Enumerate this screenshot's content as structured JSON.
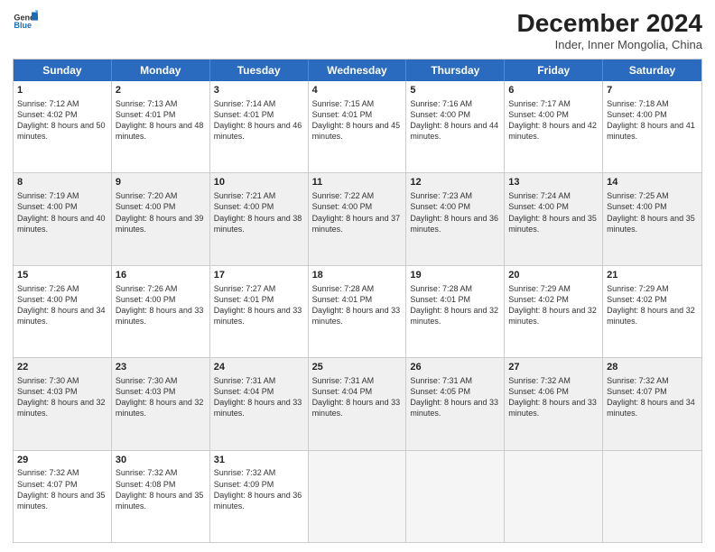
{
  "header": {
    "logo_line1": "General",
    "logo_line2": "Blue",
    "month_title": "December 2024",
    "subtitle": "Inder, Inner Mongolia, China"
  },
  "days_of_week": [
    "Sunday",
    "Monday",
    "Tuesday",
    "Wednesday",
    "Thursday",
    "Friday",
    "Saturday"
  ],
  "weeks": [
    [
      {
        "day": 1,
        "sunrise": "7:12 AM",
        "sunset": "4:02 PM",
        "daylight": "8 hours and 50 minutes."
      },
      {
        "day": 2,
        "sunrise": "7:13 AM",
        "sunset": "4:01 PM",
        "daylight": "8 hours and 48 minutes."
      },
      {
        "day": 3,
        "sunrise": "7:14 AM",
        "sunset": "4:01 PM",
        "daylight": "8 hours and 46 minutes."
      },
      {
        "day": 4,
        "sunrise": "7:15 AM",
        "sunset": "4:01 PM",
        "daylight": "8 hours and 45 minutes."
      },
      {
        "day": 5,
        "sunrise": "7:16 AM",
        "sunset": "4:00 PM",
        "daylight": "8 hours and 44 minutes."
      },
      {
        "day": 6,
        "sunrise": "7:17 AM",
        "sunset": "4:00 PM",
        "daylight": "8 hours and 42 minutes."
      },
      {
        "day": 7,
        "sunrise": "7:18 AM",
        "sunset": "4:00 PM",
        "daylight": "8 hours and 41 minutes."
      }
    ],
    [
      {
        "day": 8,
        "sunrise": "7:19 AM",
        "sunset": "4:00 PM",
        "daylight": "8 hours and 40 minutes."
      },
      {
        "day": 9,
        "sunrise": "7:20 AM",
        "sunset": "4:00 PM",
        "daylight": "8 hours and 39 minutes."
      },
      {
        "day": 10,
        "sunrise": "7:21 AM",
        "sunset": "4:00 PM",
        "daylight": "8 hours and 38 minutes."
      },
      {
        "day": 11,
        "sunrise": "7:22 AM",
        "sunset": "4:00 PM",
        "daylight": "8 hours and 37 minutes."
      },
      {
        "day": 12,
        "sunrise": "7:23 AM",
        "sunset": "4:00 PM",
        "daylight": "8 hours and 36 minutes."
      },
      {
        "day": 13,
        "sunrise": "7:24 AM",
        "sunset": "4:00 PM",
        "daylight": "8 hours and 35 minutes."
      },
      {
        "day": 14,
        "sunrise": "7:25 AM",
        "sunset": "4:00 PM",
        "daylight": "8 hours and 35 minutes."
      }
    ],
    [
      {
        "day": 15,
        "sunrise": "7:26 AM",
        "sunset": "4:00 PM",
        "daylight": "8 hours and 34 minutes."
      },
      {
        "day": 16,
        "sunrise": "7:26 AM",
        "sunset": "4:00 PM",
        "daylight": "8 hours and 33 minutes."
      },
      {
        "day": 17,
        "sunrise": "7:27 AM",
        "sunset": "4:01 PM",
        "daylight": "8 hours and 33 minutes."
      },
      {
        "day": 18,
        "sunrise": "7:28 AM",
        "sunset": "4:01 PM",
        "daylight": "8 hours and 33 minutes."
      },
      {
        "day": 19,
        "sunrise": "7:28 AM",
        "sunset": "4:01 PM",
        "daylight": "8 hours and 32 minutes."
      },
      {
        "day": 20,
        "sunrise": "7:29 AM",
        "sunset": "4:02 PM",
        "daylight": "8 hours and 32 minutes."
      },
      {
        "day": 21,
        "sunrise": "7:29 AM",
        "sunset": "4:02 PM",
        "daylight": "8 hours and 32 minutes."
      }
    ],
    [
      {
        "day": 22,
        "sunrise": "7:30 AM",
        "sunset": "4:03 PM",
        "daylight": "8 hours and 32 minutes."
      },
      {
        "day": 23,
        "sunrise": "7:30 AM",
        "sunset": "4:03 PM",
        "daylight": "8 hours and 32 minutes."
      },
      {
        "day": 24,
        "sunrise": "7:31 AM",
        "sunset": "4:04 PM",
        "daylight": "8 hours and 33 minutes."
      },
      {
        "day": 25,
        "sunrise": "7:31 AM",
        "sunset": "4:04 PM",
        "daylight": "8 hours and 33 minutes."
      },
      {
        "day": 26,
        "sunrise": "7:31 AM",
        "sunset": "4:05 PM",
        "daylight": "8 hours and 33 minutes."
      },
      {
        "day": 27,
        "sunrise": "7:32 AM",
        "sunset": "4:06 PM",
        "daylight": "8 hours and 33 minutes."
      },
      {
        "day": 28,
        "sunrise": "7:32 AM",
        "sunset": "4:07 PM",
        "daylight": "8 hours and 34 minutes."
      }
    ],
    [
      {
        "day": 29,
        "sunrise": "7:32 AM",
        "sunset": "4:07 PM",
        "daylight": "8 hours and 35 minutes."
      },
      {
        "day": 30,
        "sunrise": "7:32 AM",
        "sunset": "4:08 PM",
        "daylight": "8 hours and 35 minutes."
      },
      {
        "day": 31,
        "sunrise": "7:32 AM",
        "sunset": "4:09 PM",
        "daylight": "8 hours and 36 minutes."
      },
      null,
      null,
      null,
      null
    ]
  ]
}
